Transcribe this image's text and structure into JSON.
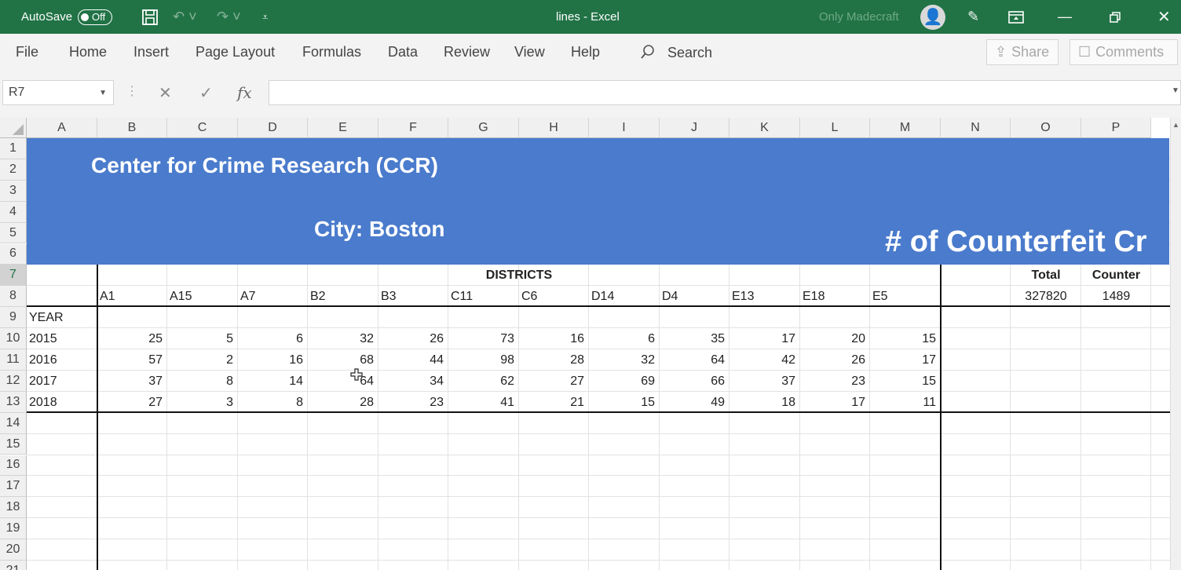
{
  "titlebar": {
    "autosave_label": "AutoSave",
    "autosave_state": "Off",
    "window_title": "lines  -  Excel",
    "user_name": "Only Madecraft",
    "bg": "#217346"
  },
  "ribbon": {
    "tabs": [
      "File",
      "Home",
      "Insert",
      "Page Layout",
      "Formulas",
      "Data",
      "Review",
      "View",
      "Help"
    ],
    "search_label": "Search",
    "share_label": "Share",
    "comments_label": "Comments"
  },
  "formula_bar": {
    "name_box": "R7",
    "fx_label": "fx",
    "content": ""
  },
  "columns": [
    "A",
    "B",
    "C",
    "D",
    "E",
    "F",
    "G",
    "H",
    "I",
    "J",
    "K",
    "L",
    "M",
    "N",
    "O",
    "P"
  ],
  "rows": [
    "1",
    "2",
    "3",
    "4",
    "5",
    "6",
    "7",
    "8",
    "9",
    "10",
    "11",
    "12",
    "13",
    "14",
    "15",
    "16",
    "17",
    "18",
    "19",
    "20",
    "21"
  ],
  "banner": {
    "title": "Center for Crime Research (CCR)",
    "city": "City: Boston",
    "counterfeit": "# of Counterfeit Cr",
    "color": "#4a7bcc"
  },
  "sheet": {
    "districts_label": "DISTRICTS",
    "year_label": "YEAR",
    "district_codes": [
      "A1",
      "A15",
      "A7",
      "B2",
      "B3",
      "C11",
      "C6",
      "D14",
      "D4",
      "E13",
      "E18",
      "E5"
    ],
    "total_label": "Total",
    "counter_label": "Counter",
    "total_value": "327820",
    "counter_value": "1489",
    "data_rows": [
      {
        "year": "2015",
        "values": [
          "25",
          "5",
          "6",
          "32",
          "26",
          "73",
          "16",
          "6",
          "35",
          "17",
          "20",
          "15"
        ]
      },
      {
        "year": "2016",
        "values": [
          "57",
          "2",
          "16",
          "68",
          "44",
          "98",
          "28",
          "32",
          "64",
          "42",
          "26",
          "17"
        ]
      },
      {
        "year": "2017",
        "values": [
          "37",
          "8",
          "14",
          "64",
          "34",
          "62",
          "27",
          "69",
          "66",
          "37",
          "23",
          "15"
        ]
      },
      {
        "year": "2018",
        "values": [
          "27",
          "3",
          "8",
          "28",
          "23",
          "41",
          "21",
          "15",
          "49",
          "18",
          "17",
          "11"
        ]
      }
    ]
  }
}
